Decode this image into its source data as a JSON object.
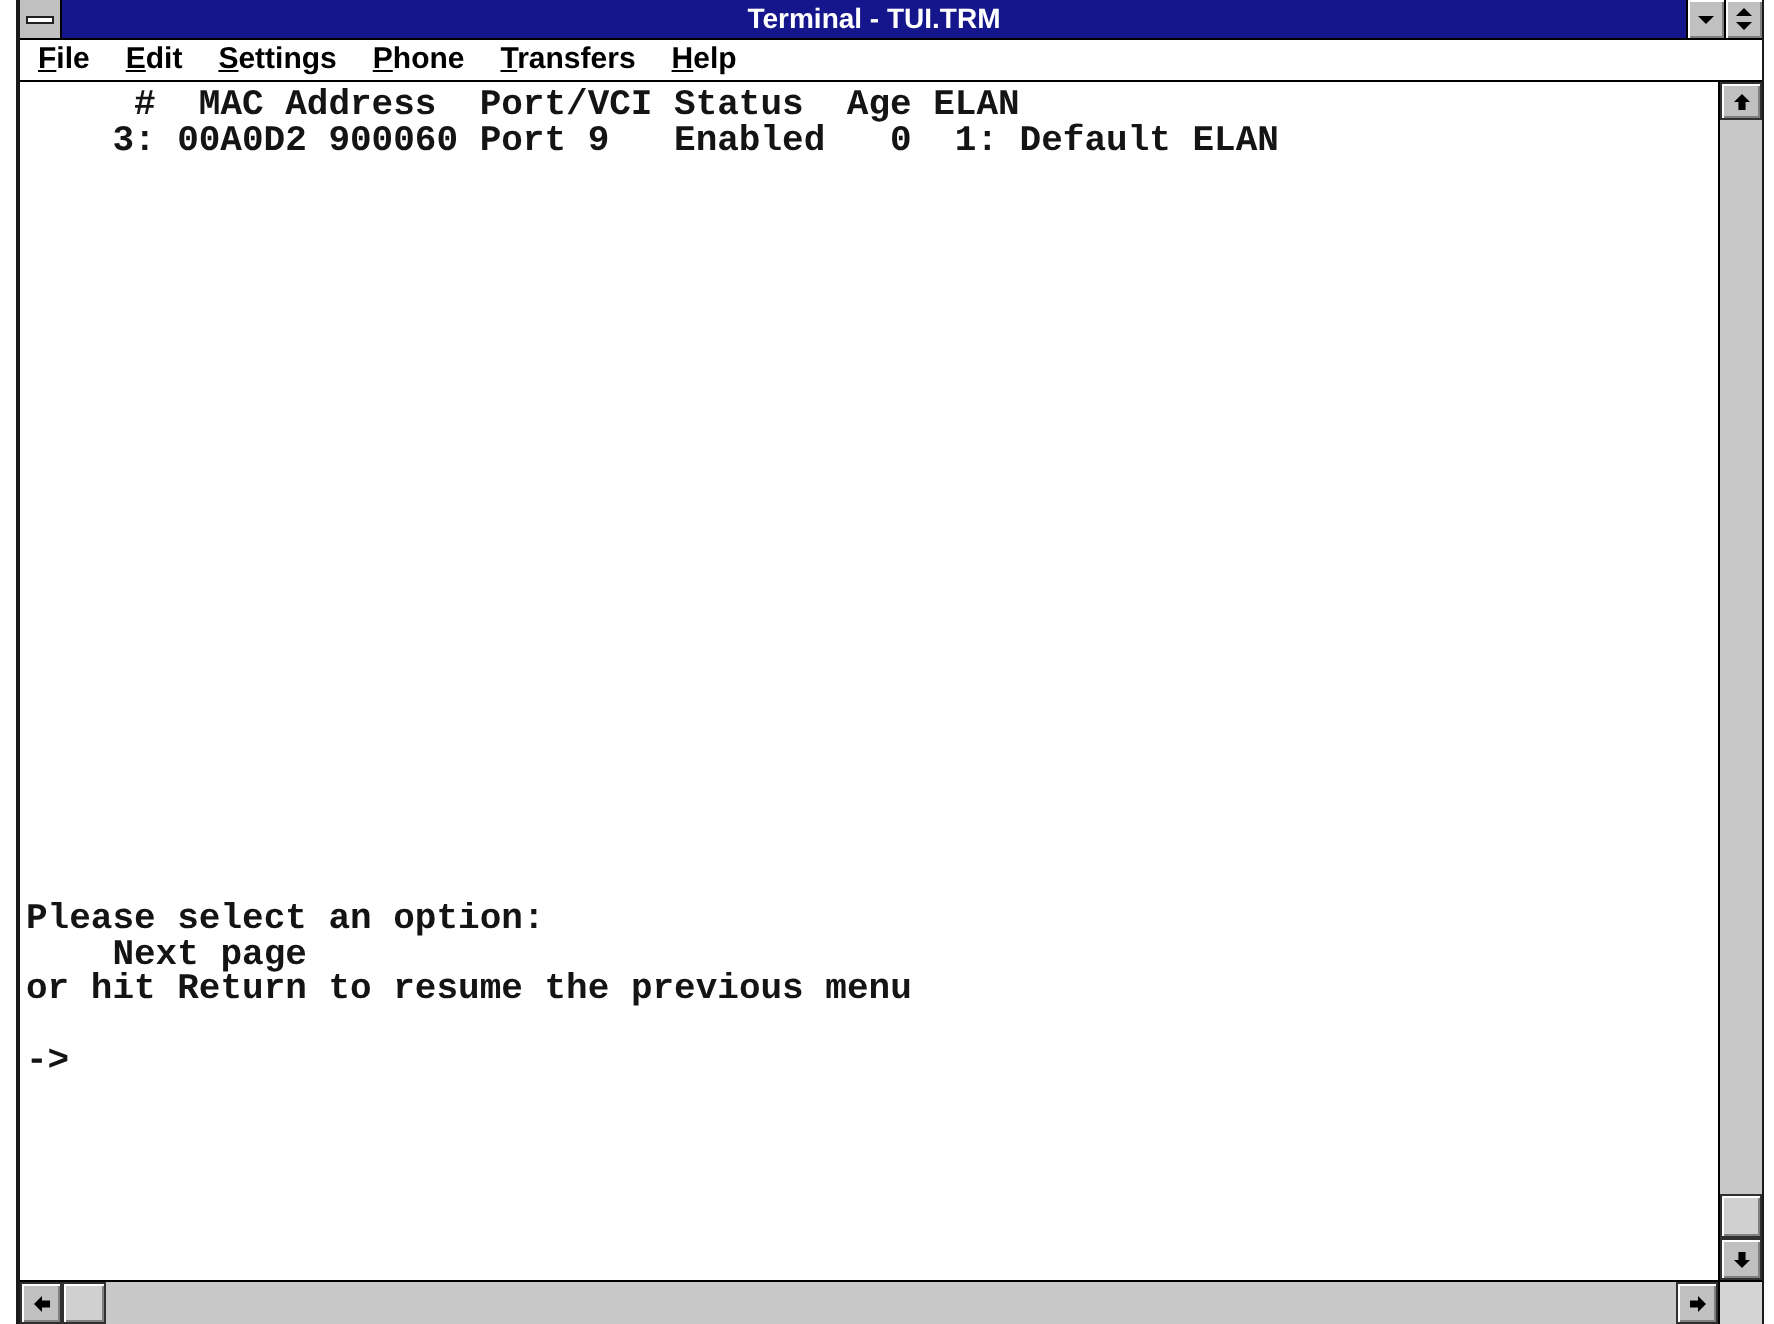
{
  "window": {
    "title": "Terminal - TUI.TRM"
  },
  "menu_bar": {
    "items": [
      "File",
      "Edit",
      "Settings",
      "Phone",
      "Transfers",
      "Help"
    ]
  },
  "terminal": {
    "table": {
      "columns": [
        "#",
        "MAC Address",
        "Port/VCI",
        "Status",
        "Age",
        "ELAN"
      ],
      "rows": [
        [
          "3:",
          "00A0D2 900060",
          "Port 9",
          "Enabled",
          "0",
          "1: Default ELAN"
        ]
      ]
    },
    "prompt": {
      "heading": "Please select an option:",
      "options": [
        "Next page"
      ],
      "hint": "or hit Return to resume the previous menu",
      "input_prompt": "->"
    }
  }
}
